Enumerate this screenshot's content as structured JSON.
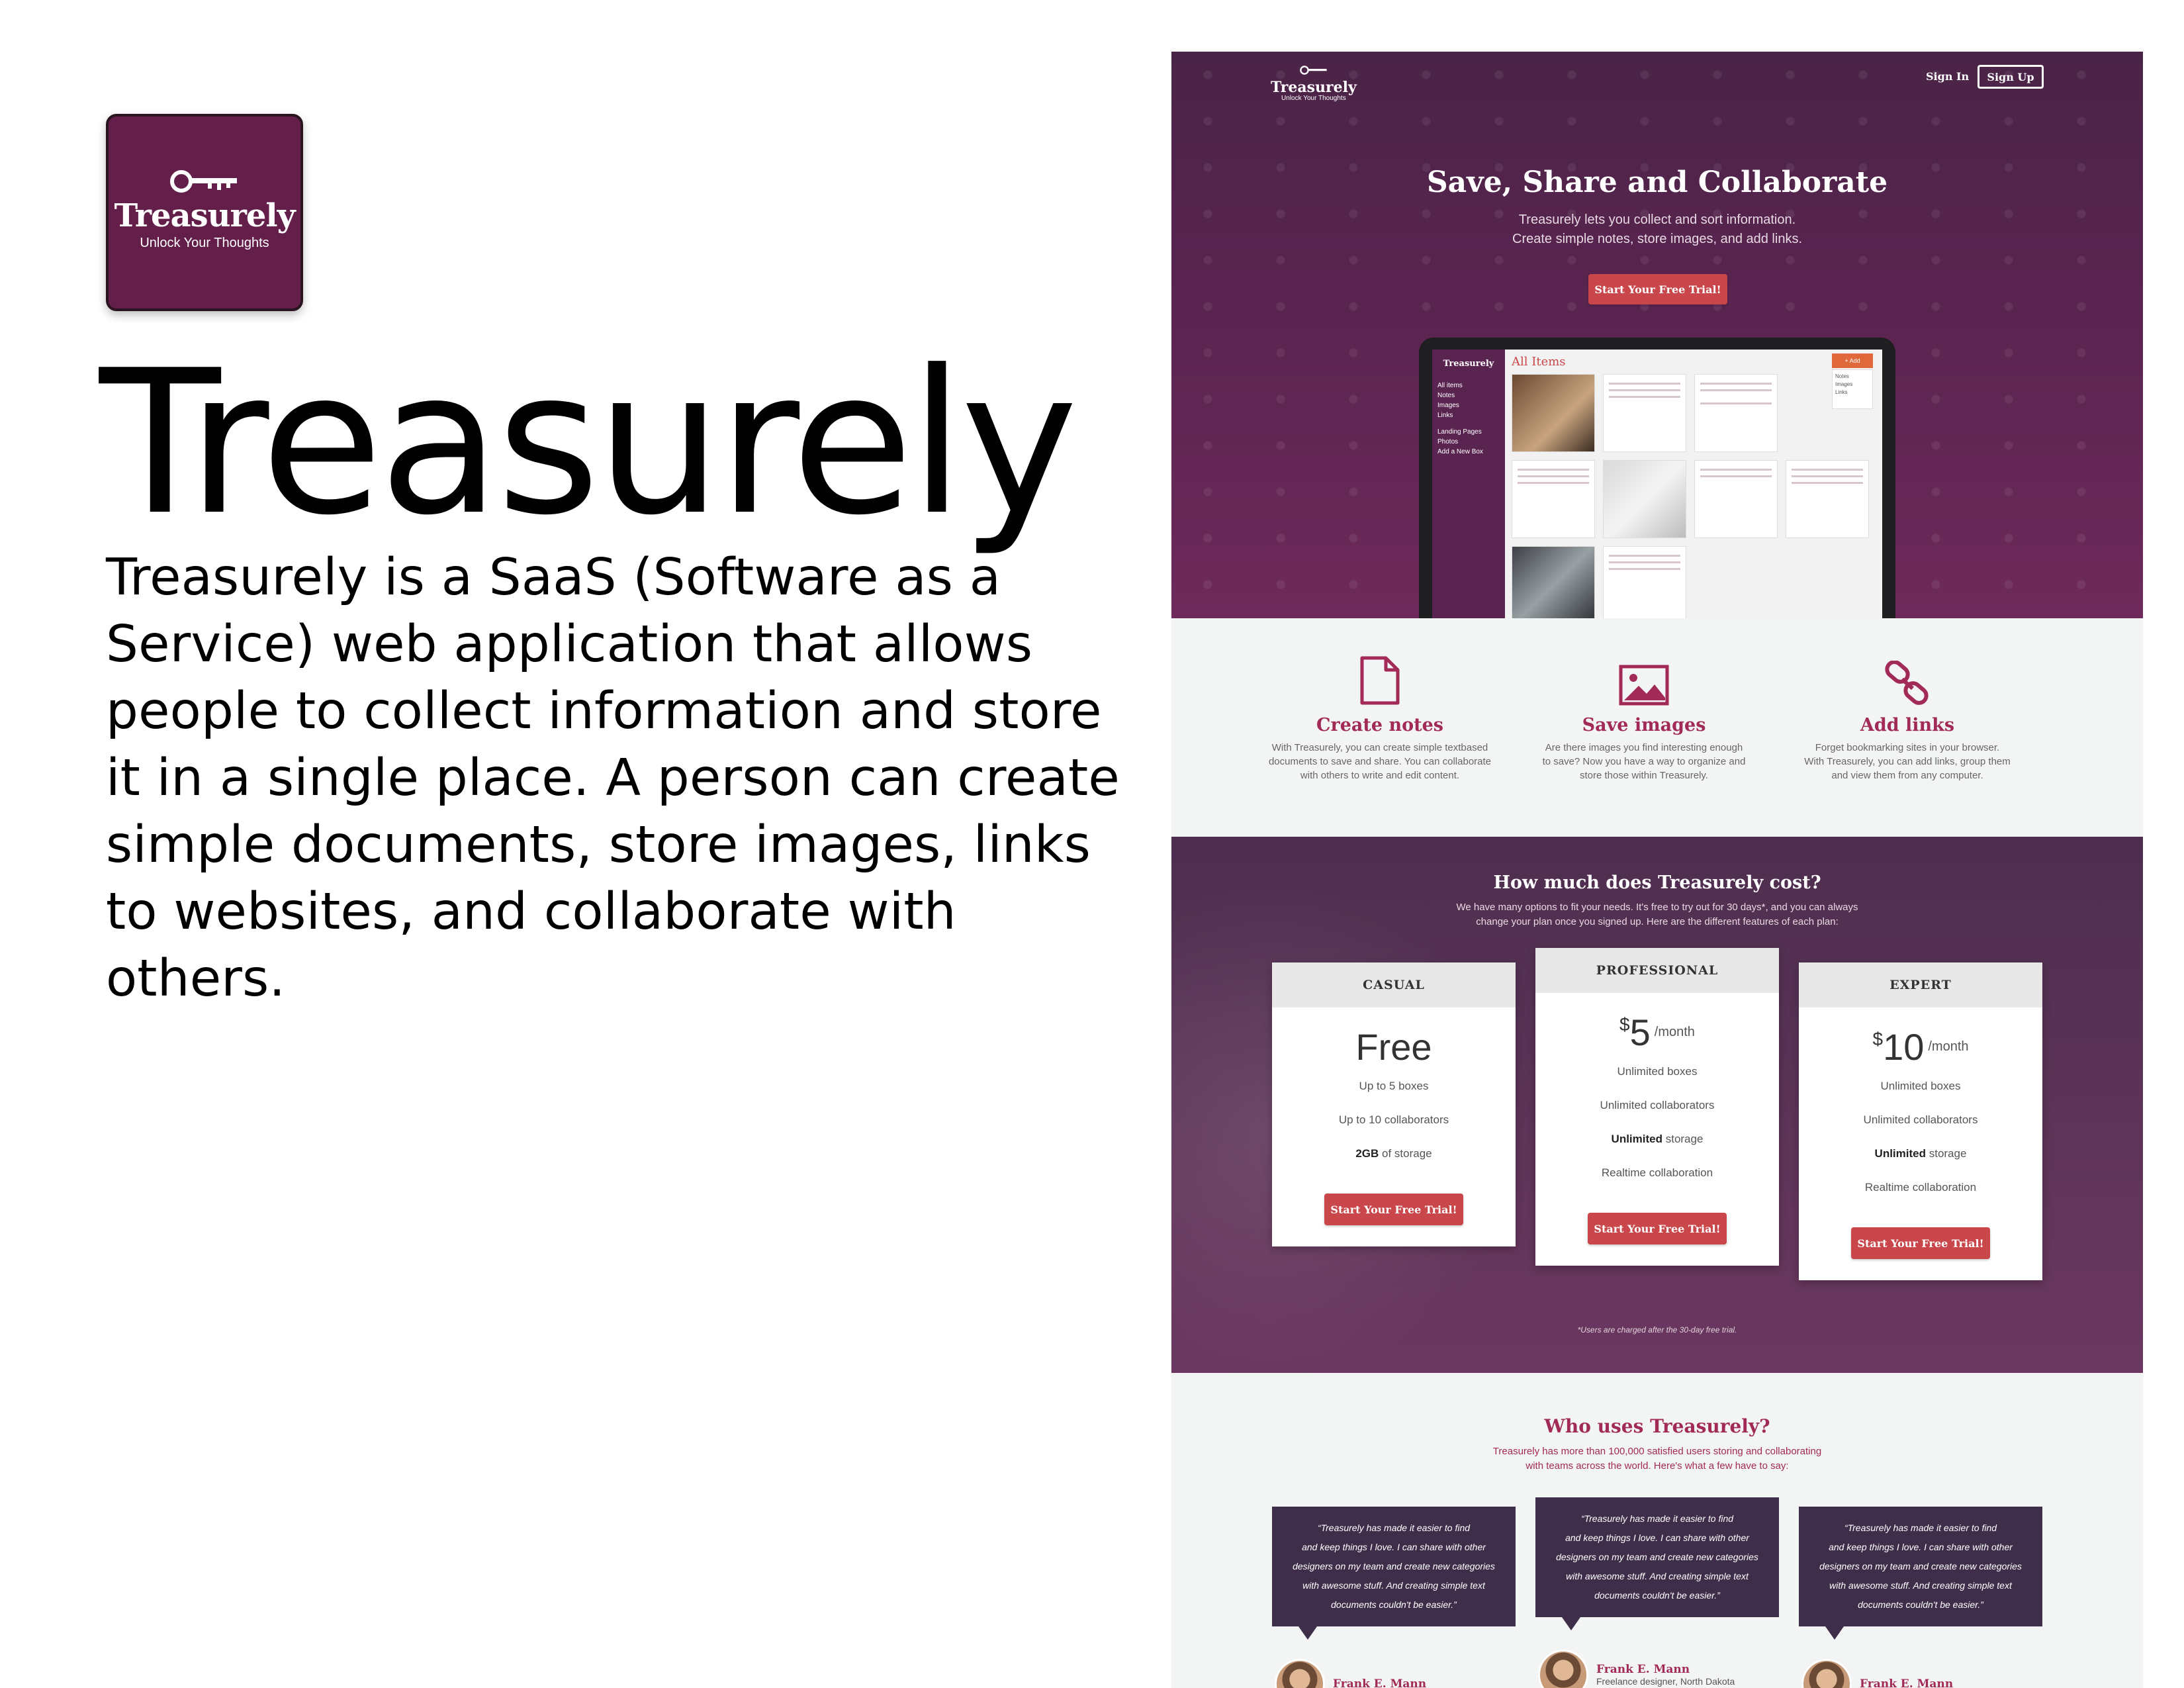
{
  "left": {
    "icon": {
      "brand": "Treasurely",
      "tagline": "Unlock Your Thoughts",
      "bg": "#631f4a"
    },
    "title": "Treasurely",
    "description": "Treasurely is a SaaS (Software as a Service) web application that allows people to collect information and store it in a single place. A person can create simple documents, store images, links to websites, and collaborate with others."
  },
  "mock": {
    "nav": {
      "brand": "Treasurely",
      "tagline": "Unlock Your Thoughts",
      "sign_in": "Sign In",
      "sign_up": "Sign Up"
    },
    "hero": {
      "heading": "Save, Share and Collaborate",
      "sub1": "Treasurely lets you collect and sort information.",
      "sub2": "Create simple notes, store images, and add links.",
      "cta": "Start Your Free Trial!"
    },
    "app_screen": {
      "brand": "Treasurely",
      "title": "All Items",
      "add": "+ Add",
      "sidebar": [
        "All items",
        "Notes",
        "Images",
        "Links",
        "Landing Pages",
        "Photos",
        "Add a New Box"
      ],
      "menu": [
        "Notes",
        "Images",
        "Links"
      ]
    },
    "features": [
      {
        "icon": "document-icon",
        "title": "Create notes",
        "text1": "With Treasurely, you can create simple textbased",
        "text2": "documents to save and share. You can collaborate",
        "text3": "with others to write and edit content."
      },
      {
        "icon": "image-icon",
        "title": "Save images",
        "text1": "Are there images you find interesting enough",
        "text2": "to save? Now you have a way to organize and",
        "text3": "store those within Treasurely."
      },
      {
        "icon": "link-icon",
        "title": "Add links",
        "text1": "Forget bookmarking sites in your browser.",
        "text2": "With Treasurely, you can add links, group them",
        "text3": "and view them from any computer."
      }
    ],
    "pricing": {
      "heading": "How much does Treasurely cost?",
      "sub1": "We have many options to fit your needs. It's free to try out for 30 days*, and you can always",
      "sub2": "change your plan once you signed up. Here are the different features of each plan:",
      "note": "*Users are charged after the 30-day free trial.",
      "plans": [
        {
          "name": "CASUAL",
          "price": "Free",
          "r1": "Up to 5 boxes",
          "r2": "Up to 10 collaborators",
          "r3b": "2GB",
          "r3": " of storage",
          "cta": "Start Your Free Trial!"
        },
        {
          "name": "PROFESSIONAL",
          "currency": "$",
          "amount": "5",
          "per": "/month",
          "r1": "Unlimited boxes",
          "r2": "Unlimited collaborators",
          "r3b": "Unlimited",
          "r3": " storage",
          "r4": "Realtime collaboration",
          "cta": "Start Your Free Trial!"
        },
        {
          "name": "EXPERT",
          "currency": "$",
          "amount": "10",
          "per": "/month",
          "r1": "Unlimited boxes",
          "r2": "Unlimited collaborators",
          "r3b": "Unlimited",
          "r3": " storage",
          "r4": "Realtime collaboration",
          "cta": "Start Your Free Trial!"
        }
      ]
    },
    "testimonials": {
      "heading": "Who uses Treasurely?",
      "sub1": "Treasurely has more than 100,000 satisfied users storing and collaborating",
      "sub2": "with teams across the world. Here's what a few have to say:",
      "quote_l1": "“Treasurely has made it easier to find",
      "quote_l2": "and keep things I love. I can share with other",
      "quote_l3": "designers on my team and create new categories",
      "quote_l4": "with awesome stuff. And creating simple text",
      "quote_l5": "documents couldn't be easier.”",
      "name": "Frank E. Mann",
      "role": "Freelance designer, North Dakota"
    }
  }
}
